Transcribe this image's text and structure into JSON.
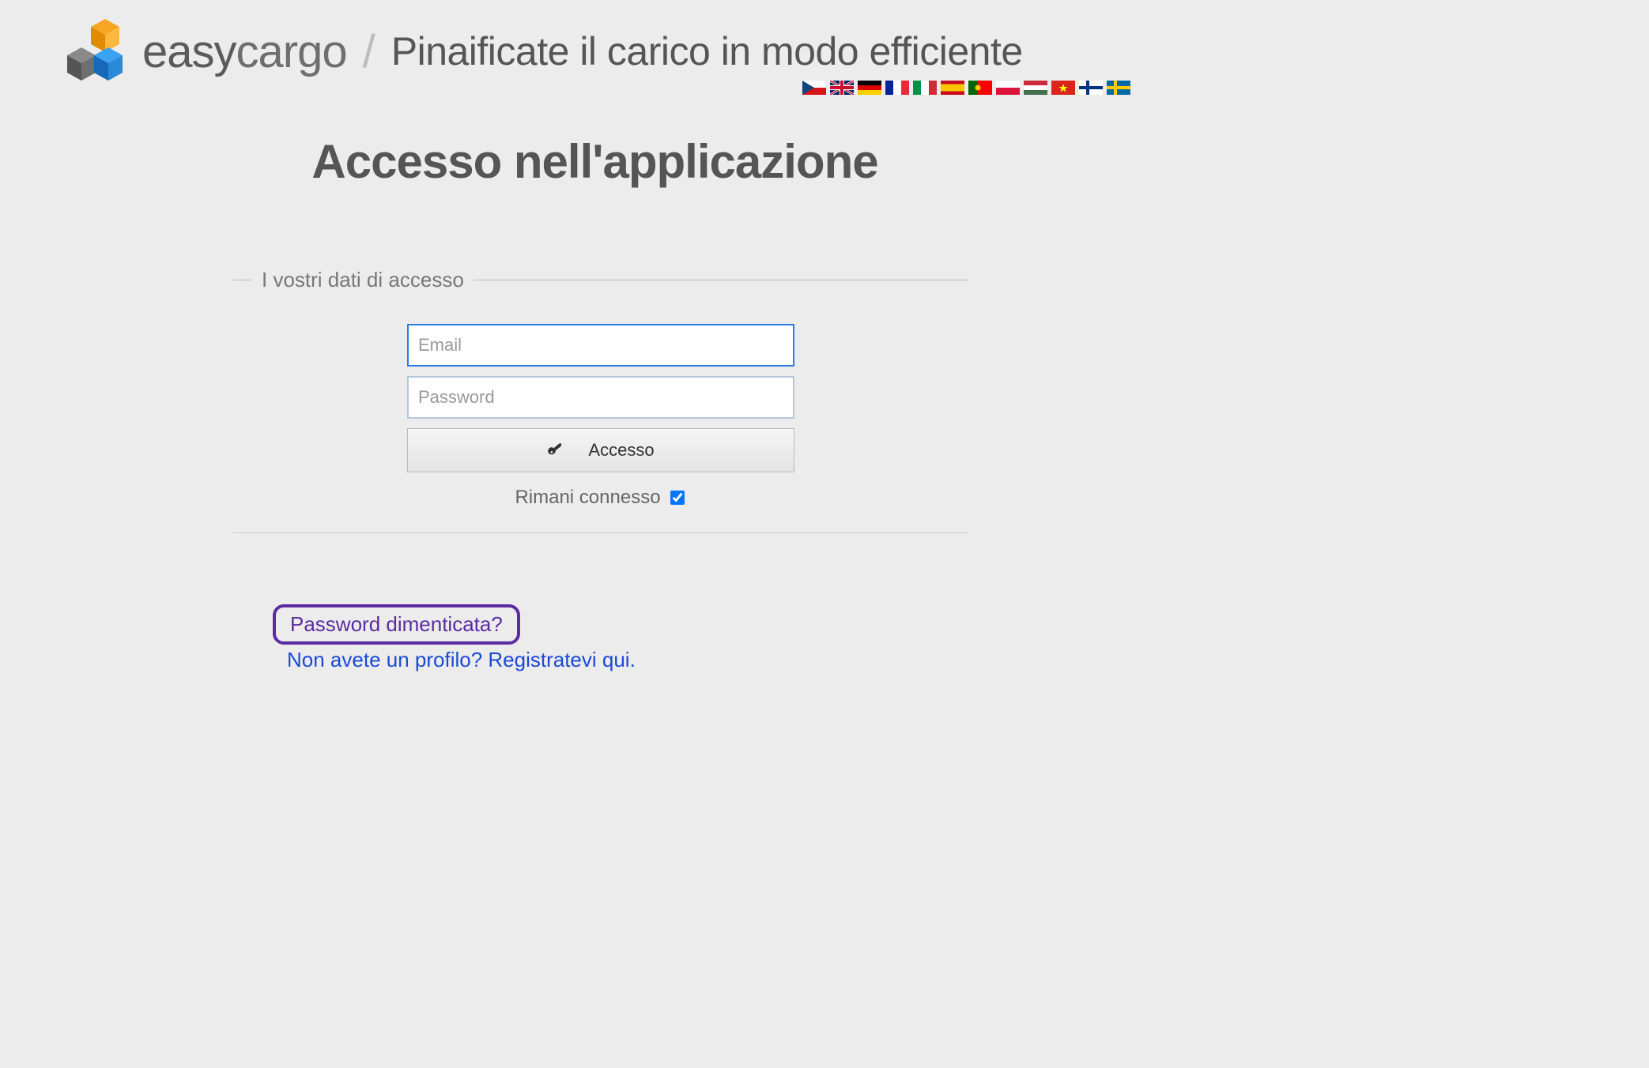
{
  "header": {
    "logo_part1": "easy",
    "logo_part2": "cargo",
    "tagline": "Pinaificate il carico in modo efficiente"
  },
  "languages": [
    "cz",
    "gb",
    "de",
    "fr",
    "it",
    "es",
    "pt",
    "pl",
    "hu",
    "vn",
    "fi",
    "se"
  ],
  "page": {
    "title": "Accesso nell'applicazione",
    "legend": "I vostri dati di accesso",
    "email_placeholder": "Email",
    "password_placeholder": "Password",
    "login_button": "Accesso",
    "remember_label": "Rimani connesso",
    "remember_checked": true
  },
  "links": {
    "forgot": "Password dimenticata?",
    "register": "Non avete un profilo? Registratevi qui."
  }
}
